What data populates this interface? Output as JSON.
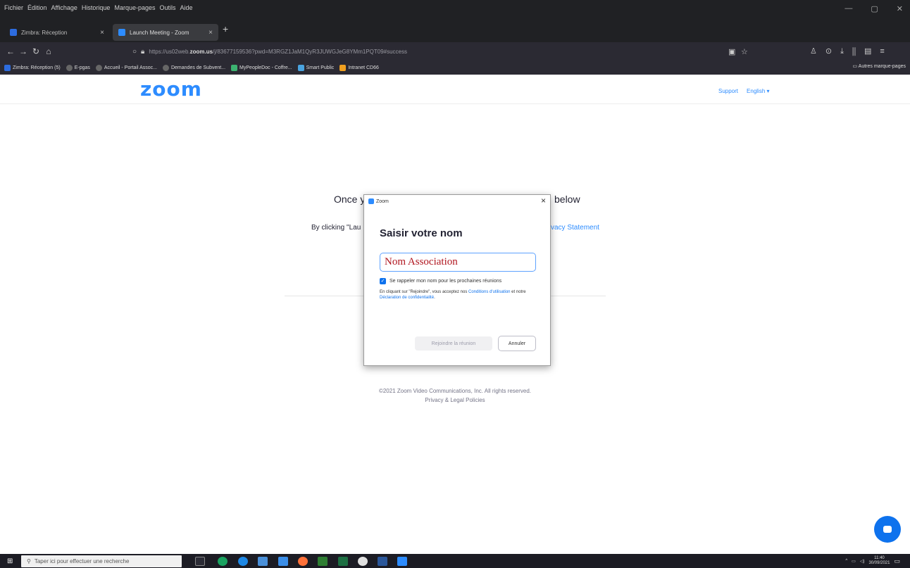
{
  "browser": {
    "menu": [
      "Fichier",
      "Édition",
      "Affichage",
      "Historique",
      "Marque-pages",
      "Outils",
      "Aide"
    ],
    "tabs": [
      {
        "label": "Zimbra: Réception",
        "color": "#2d6cdf"
      },
      {
        "label": "Launch Meeting - Zoom",
        "color": "#2d8cff"
      }
    ],
    "url_prefix": "https://us02web.",
    "url_domain": "zoom.us",
    "url_rest": "/j/83677159536?pwd=M3RGZ1JaM1QyR3JUWGJeG8YMm1PQT09#success",
    "bookmarks": [
      {
        "label": "Zimbra: Réception (5)",
        "color": "#2d6cdf"
      },
      {
        "label": "E-pgas",
        "color": "#666"
      },
      {
        "label": "Accueil - Portail Assoc...",
        "color": "#666"
      },
      {
        "label": "Demandes de Subvent...",
        "color": "#666"
      },
      {
        "label": "MyPeopleDoc - Coffre...",
        "color": "#3cb371"
      },
      {
        "label": "Smart Public",
        "color": "#4aa3df"
      },
      {
        "label": "Intranet CD66",
        "color": "#f0a020"
      }
    ],
    "other_bookmarks": "Autres marque-pages"
  },
  "zoom_page": {
    "logo": "zoom",
    "support_link": "Support",
    "language": "English ▾",
    "once_text": "Once y",
    "once_tail": "below",
    "by_clicking": "By clicking \"Lau",
    "privacy_link": "vacy Statement",
    "copyright": "©2021 Zoom Video Communications, Inc. All rights reserved.",
    "legal": "Privacy & Legal Policies"
  },
  "dialog": {
    "title": "Zoom",
    "heading": "Saisir votre nom",
    "name_value": "Nom Association",
    "remember_label": "Se rappeler mon nom pour les prochaines réunions",
    "terms_a": "En cliquant sur \"Rejoindre\", vous acceptez nos ",
    "terms_link1": "Conditions d'utilisation",
    "terms_b": " et notre ",
    "terms_link2": "Déclaration de confidentialité",
    "terms_c": ".",
    "join_label": "Rejoindre la réunion",
    "cancel_label": "Annuler"
  },
  "taskbar": {
    "search_placeholder": "Taper ici pour effectuer une recherche",
    "time": "11:40",
    "date": "30/09/2021"
  }
}
